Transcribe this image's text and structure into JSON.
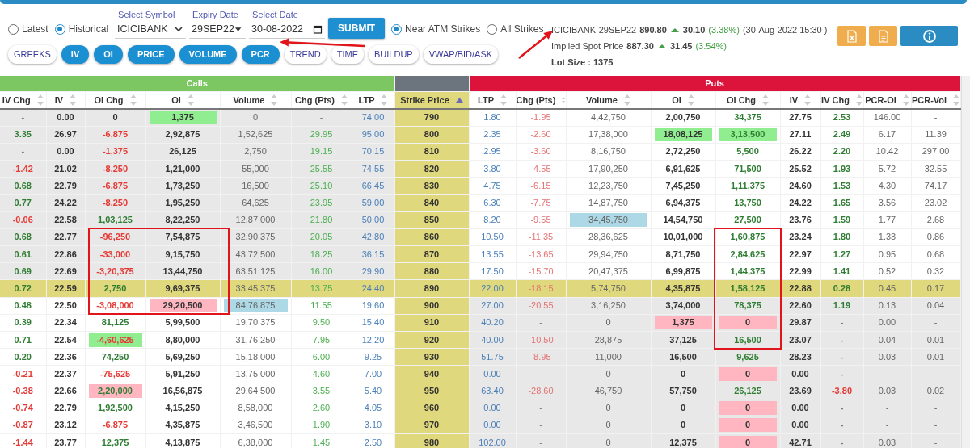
{
  "mode_options": [
    {
      "label": "Latest",
      "selected": false
    },
    {
      "label": "Historical",
      "selected": true
    }
  ],
  "symbol": {
    "label": "Select Symbol",
    "value": "ICICIBANK"
  },
  "expiry": {
    "label": "Expiry Date",
    "value": "29SEP22"
  },
  "date": {
    "label": "Select Date",
    "value": "30-08-2022"
  },
  "submit": "SUBMIT",
  "strike_options": [
    {
      "label": "Near ATM Strikes",
      "selected": true
    },
    {
      "label": "All Strikes",
      "selected": false
    }
  ],
  "view_tabs": [
    {
      "label": "GREEKS",
      "selected": false
    },
    {
      "label": "IV",
      "selected": true
    },
    {
      "label": "OI",
      "selected": true
    },
    {
      "label": "PRICE",
      "selected": true
    },
    {
      "label": "VOLUME",
      "selected": true
    },
    {
      "label": "PCR",
      "selected": true
    },
    {
      "label": "TREND",
      "selected": false
    },
    {
      "label": "TIME",
      "selected": false
    },
    {
      "label": "BUILDUP",
      "selected": false
    },
    {
      "label": "VWAP/BID/ASK",
      "selected": false
    }
  ],
  "quote": {
    "symbol": "ICICIBANK-29SEP22",
    "price": "890.80",
    "up": true,
    "change": "30.10",
    "percent": "(3.38%)",
    "time": "(30-Aug-2022 15:30 )"
  },
  "implied": {
    "label": "Implied Spot Price",
    "price": "887.30",
    "up": true,
    "change": "31.45",
    "percent": "(3.54%)"
  },
  "lot_size": "Lot Size : 1375",
  "toolbar": [
    {
      "kind": "excel"
    },
    {
      "kind": "document"
    },
    {
      "kind": "info"
    }
  ],
  "table": {
    "calls_title": "Calls",
    "puts_title": "Puts",
    "calls_columns": [
      {
        "label": "IV Chg",
        "kind": "change",
        "sorted": false
      },
      {
        "label": "IV",
        "kind": "iv",
        "sorted": false
      },
      {
        "label": "OI Chg",
        "kind": "oi_change",
        "sorted": false
      },
      {
        "label": "OI",
        "kind": "oi",
        "sorted": false
      },
      {
        "label": "Volume",
        "kind": "volume",
        "sorted": false
      },
      {
        "label": "Chg (Pts)",
        "kind": "points",
        "sorted": false
      },
      {
        "label": "LTP",
        "kind": "ltp",
        "sorted": false
      }
    ],
    "strike_column": {
      "label": "Strike Price",
      "sorted": true
    },
    "puts_columns": [
      {
        "label": "LTP",
        "kind": "ltp",
        "sorted": false
      },
      {
        "label": "Chg (Pts)",
        "kind": "points",
        "sorted": false
      },
      {
        "label": "Volume",
        "kind": "volume",
        "sorted": false
      },
      {
        "label": "OI",
        "kind": "oi",
        "sorted": false
      },
      {
        "label": "OI Chg",
        "kind": "oi_change",
        "sorted": false
      },
      {
        "label": "IV",
        "kind": "iv",
        "sorted": false
      },
      {
        "label": "IV Chg",
        "kind": "change",
        "sorted": false
      },
      {
        "label": "PCR-OI",
        "kind": "ratio",
        "sorted": false
      },
      {
        "label": "PCR-Vol",
        "kind": "ratio",
        "sorted": false
      }
    ],
    "rows": [
      {
        "strike": "790",
        "atm": false,
        "itm_calls": true,
        "itm_puts": false,
        "boxed_calls": false,
        "boxed_puts": false,
        "calls": [
          {
            "text": "-",
            "kind": "nil"
          },
          "0.00",
          {
            "text": "0",
            "kind": "nil"
          },
          {
            "text": "1,375",
            "color": "#90ee90"
          },
          "0",
          {
            "text": "-",
            "kind": "nil"
          },
          "74.00"
        ],
        "puts": [
          "1.80",
          {
            "text": "-1.95",
            "kind": "fall"
          },
          "4,42,750",
          "2,00,750",
          {
            "text": "34,375",
            "kind": "rise"
          },
          "27.75",
          {
            "text": "2.53",
            "kind": "rise"
          },
          "146.00",
          "-"
        ]
      },
      {
        "strike": "800",
        "atm": false,
        "itm_calls": true,
        "itm_puts": false,
        "boxed_calls": false,
        "boxed_puts": false,
        "calls": [
          {
            "text": "3.35",
            "kind": "rise"
          },
          "26.97",
          {
            "text": "-6,875",
            "kind": "fall"
          },
          "2,92,875",
          "1,52,625",
          {
            "text": "29.95",
            "kind": "rise"
          },
          "95.00"
        ],
        "puts": [
          "2.35",
          {
            "text": "-2.60",
            "kind": "fall"
          },
          "17,38,000",
          {
            "text": "18,08,125",
            "color": "#90ee90"
          },
          {
            "text": "3,13,500",
            "kind": "rise",
            "color": "#90ee90"
          },
          "27.11",
          {
            "text": "2.49",
            "kind": "rise"
          },
          "6.17",
          "11.39"
        ]
      },
      {
        "strike": "810",
        "atm": false,
        "itm_calls": true,
        "itm_puts": false,
        "boxed_calls": false,
        "boxed_puts": false,
        "calls": [
          {
            "text": "-",
            "kind": "nil"
          },
          "0.00",
          {
            "text": "-1,375",
            "kind": "fall"
          },
          "26,125",
          "2,750",
          {
            "text": "19.15",
            "kind": "rise"
          },
          "70.15"
        ],
        "puts": [
          "2.95",
          {
            "text": "-3.60",
            "kind": "fall"
          },
          "8,16,750",
          "2,72,250",
          {
            "text": "5,500",
            "kind": "rise"
          },
          "26.22",
          {
            "text": "2.20",
            "kind": "rise"
          },
          "10.42",
          "297.00"
        ]
      },
      {
        "strike": "820",
        "atm": false,
        "itm_calls": true,
        "itm_puts": false,
        "boxed_calls": false,
        "boxed_puts": false,
        "calls": [
          {
            "text": "-1.42",
            "kind": "fall"
          },
          "21.02",
          {
            "text": "-8,250",
            "kind": "fall"
          },
          "1,21,000",
          "55,000",
          {
            "text": "25.55",
            "kind": "rise"
          },
          "74.55"
        ],
        "puts": [
          "3.80",
          {
            "text": "-4.55",
            "kind": "fall"
          },
          "17,90,250",
          "6,91,625",
          {
            "text": "71,500",
            "kind": "rise"
          },
          "25.52",
          {
            "text": "1.93",
            "kind": "rise"
          },
          "5.72",
          "32.55"
        ]
      },
      {
        "strike": "830",
        "atm": false,
        "itm_calls": true,
        "itm_puts": false,
        "boxed_calls": false,
        "boxed_puts": false,
        "calls": [
          {
            "text": "0.68",
            "kind": "rise"
          },
          "22.79",
          {
            "text": "-6,875",
            "kind": "fall"
          },
          "1,73,250",
          "16,500",
          {
            "text": "25.10",
            "kind": "rise"
          },
          "66.45"
        ],
        "puts": [
          "4.75",
          {
            "text": "-6.15",
            "kind": "fall"
          },
          "12,23,750",
          "7,45,250",
          {
            "text": "1,11,375",
            "kind": "rise"
          },
          "24.60",
          {
            "text": "1.53",
            "kind": "rise"
          },
          "4.30",
          "74.17"
        ]
      },
      {
        "strike": "840",
        "atm": false,
        "itm_calls": true,
        "itm_puts": false,
        "boxed_calls": false,
        "boxed_puts": false,
        "calls": [
          {
            "text": "0.77",
            "kind": "rise"
          },
          "24.22",
          {
            "text": "-8,250",
            "kind": "fall"
          },
          "1,95,250",
          "64,625",
          {
            "text": "23.95",
            "kind": "rise"
          },
          "59.00"
        ],
        "puts": [
          "6.30",
          {
            "text": "-7.75",
            "kind": "fall"
          },
          "14,87,750",
          "6,94,375",
          {
            "text": "13,750",
            "kind": "rise"
          },
          "24.22",
          {
            "text": "1.65",
            "kind": "rise"
          },
          "3.56",
          "23.02"
        ]
      },
      {
        "strike": "850",
        "atm": false,
        "itm_calls": true,
        "itm_puts": false,
        "boxed_calls": false,
        "boxed_puts": false,
        "calls": [
          {
            "text": "-0.06",
            "kind": "fall"
          },
          "22.58",
          {
            "text": "1,03,125",
            "kind": "rise"
          },
          "8,22,250",
          "12,87,000",
          {
            "text": "21.80",
            "kind": "rise"
          },
          "50.00"
        ],
        "puts": [
          "8.20",
          {
            "text": "-9.55",
            "kind": "fall"
          },
          {
            "text": "34,45,750",
            "color": "#add8e6"
          },
          "14,54,750",
          {
            "text": "27,500",
            "kind": "rise"
          },
          "23.76",
          {
            "text": "1.59",
            "kind": "rise"
          },
          "1.77",
          "2.68"
        ]
      },
      {
        "strike": "860",
        "atm": false,
        "itm_calls": true,
        "itm_puts": false,
        "boxed_calls": true,
        "boxed_puts": true,
        "calls": [
          {
            "text": "0.68",
            "kind": "rise"
          },
          "22.77",
          {
            "text": "-96,250",
            "kind": "fall"
          },
          "7,54,875",
          "32,90,375",
          {
            "text": "20.05",
            "kind": "rise"
          },
          "42.80"
        ],
        "puts": [
          "10.50",
          {
            "text": "-11.35",
            "kind": "fall"
          },
          "28,36,625",
          "10,01,000",
          {
            "text": "1,60,875",
            "kind": "rise"
          },
          "23.24",
          {
            "text": "1.80",
            "kind": "rise"
          },
          "1.33",
          "0.86"
        ]
      },
      {
        "strike": "870",
        "atm": false,
        "itm_calls": true,
        "itm_puts": false,
        "boxed_calls": true,
        "boxed_puts": true,
        "calls": [
          {
            "text": "0.61",
            "kind": "rise"
          },
          "22.86",
          {
            "text": "-33,000",
            "kind": "fall"
          },
          "9,15,750",
          "43,72,500",
          {
            "text": "18.25",
            "kind": "rise"
          },
          "36.15"
        ],
        "puts": [
          "13.55",
          {
            "text": "-13.65",
            "kind": "fall"
          },
          "29,94,750",
          "8,71,750",
          {
            "text": "2,84,625",
            "kind": "rise"
          },
          "22.97",
          {
            "text": "1.27",
            "kind": "rise"
          },
          "0.95",
          "0.68"
        ]
      },
      {
        "strike": "880",
        "atm": false,
        "itm_calls": true,
        "itm_puts": false,
        "boxed_calls": true,
        "boxed_puts": true,
        "calls": [
          {
            "text": "0.69",
            "kind": "rise"
          },
          "22.69",
          {
            "text": "-3,20,375",
            "kind": "fall"
          },
          "13,44,750",
          "63,51,125",
          {
            "text": "16.00",
            "kind": "rise"
          },
          "29.90"
        ],
        "puts": [
          "17.50",
          {
            "text": "-15.70",
            "kind": "fall"
          },
          "20,47,375",
          "6,99,875",
          {
            "text": "1,44,375",
            "kind": "rise"
          },
          "22.99",
          {
            "text": "1.41",
            "kind": "rise"
          },
          "0.52",
          "0.32"
        ]
      },
      {
        "strike": "890",
        "atm": true,
        "itm_calls": false,
        "itm_puts": false,
        "boxed_calls": true,
        "boxed_puts": true,
        "calls": [
          {
            "text": "0.72",
            "kind": "rise"
          },
          "22.59",
          {
            "text": "2,750",
            "kind": "rise"
          },
          "9,69,375",
          "33,45,375",
          {
            "text": "13.75",
            "kind": "rise"
          },
          "24.40"
        ],
        "puts": [
          "22.00",
          {
            "text": "-18.15",
            "kind": "fall"
          },
          "5,74,750",
          "4,35,875",
          {
            "text": "1,58,125",
            "kind": "rise"
          },
          "22.88",
          {
            "text": "0.28",
            "kind": "rise"
          },
          "0.45",
          "0.17"
        ]
      },
      {
        "strike": "900",
        "atm": false,
        "itm_calls": false,
        "itm_puts": true,
        "boxed_calls": true,
        "boxed_puts": true,
        "calls": [
          {
            "text": "0.48",
            "kind": "rise"
          },
          "22.50",
          {
            "text": "-3,08,000",
            "kind": "fall"
          },
          {
            "text": "29,20,500",
            "color": "#ffb6c1"
          },
          {
            "text": "84,76,875",
            "color": "#add8e6"
          },
          {
            "text": "11.55",
            "kind": "rise"
          },
          "19.60"
        ],
        "puts": [
          "27.00",
          {
            "text": "-20.55",
            "kind": "fall"
          },
          "3,16,250",
          "3,74,000",
          {
            "text": "78,375",
            "kind": "rise"
          },
          "22.60",
          {
            "text": "1.19",
            "kind": "rise"
          },
          "0.13",
          "0.04"
        ]
      },
      {
        "strike": "910",
        "atm": false,
        "itm_calls": false,
        "itm_puts": true,
        "boxed_calls": false,
        "boxed_puts": true,
        "calls": [
          {
            "text": "0.39",
            "kind": "rise"
          },
          "22.34",
          {
            "text": "81,125",
            "kind": "rise"
          },
          "5,99,500",
          "19,70,375",
          {
            "text": "9.50",
            "kind": "rise"
          },
          "15.40"
        ],
        "puts": [
          "40.20",
          {
            "text": "-",
            "kind": "nil"
          },
          "0",
          {
            "text": "1,375",
            "color": "#ffb6c1"
          },
          {
            "text": "0",
            "kind": "nil",
            "color": "#ffb6c1"
          },
          "29.87",
          {
            "text": "-",
            "kind": "nil"
          },
          "0.00",
          "-"
        ]
      },
      {
        "strike": "920",
        "atm": false,
        "itm_calls": false,
        "itm_puts": true,
        "boxed_calls": false,
        "boxed_puts": true,
        "calls": [
          {
            "text": "0.71",
            "kind": "rise"
          },
          "22.54",
          {
            "text": "-4,60,625",
            "kind": "fall",
            "color": "#90ee90"
          },
          "8,80,000",
          "31,76,250",
          {
            "text": "7.95",
            "kind": "rise"
          },
          "12.20"
        ],
        "puts": [
          "40.00",
          {
            "text": "-10.50",
            "kind": "fall"
          },
          "28,875",
          "37,125",
          {
            "text": "16,500",
            "kind": "rise"
          },
          "23.07",
          {
            "text": "-",
            "kind": "nil"
          },
          "0.04",
          "0.01"
        ]
      },
      {
        "strike": "930",
        "atm": false,
        "itm_calls": false,
        "itm_puts": true,
        "boxed_calls": false,
        "boxed_puts": false,
        "calls": [
          {
            "text": "0.20",
            "kind": "rise"
          },
          "22.36",
          {
            "text": "74,250",
            "kind": "rise"
          },
          "5,69,250",
          "15,18,000",
          {
            "text": "6.00",
            "kind": "rise"
          },
          "9.25"
        ],
        "puts": [
          "51.75",
          {
            "text": "-8.95",
            "kind": "fall"
          },
          "11,000",
          "16,500",
          {
            "text": "9,625",
            "kind": "rise"
          },
          "28.23",
          {
            "text": "-",
            "kind": "nil"
          },
          "0.03",
          "0.01"
        ]
      },
      {
        "strike": "940",
        "atm": false,
        "itm_calls": false,
        "itm_puts": true,
        "boxed_calls": false,
        "boxed_puts": false,
        "calls": [
          {
            "text": "-0.21",
            "kind": "fall"
          },
          "22.37",
          {
            "text": "-75,625",
            "kind": "fall"
          },
          "5,91,250",
          "13,75,000",
          {
            "text": "4.60",
            "kind": "rise"
          },
          "7.00"
        ],
        "puts": [
          "0.00",
          {
            "text": "-",
            "kind": "nil"
          },
          "0",
          "0",
          {
            "text": "0",
            "kind": "nil",
            "color": "#ffb6c1"
          },
          "0.00",
          {
            "text": "-",
            "kind": "nil"
          },
          "-",
          "-"
        ]
      },
      {
        "strike": "950",
        "atm": false,
        "itm_calls": false,
        "itm_puts": true,
        "boxed_calls": false,
        "boxed_puts": false,
        "calls": [
          {
            "text": "-0.38",
            "kind": "fall"
          },
          "22.66",
          {
            "text": "2,20,000",
            "kind": "rise",
            "color": "#ffb6c1"
          },
          "16,56,875",
          "29,64,500",
          {
            "text": "3.55",
            "kind": "rise"
          },
          "5.40"
        ],
        "puts": [
          "63.40",
          {
            "text": "-28.60",
            "kind": "fall"
          },
          "46,750",
          "57,750",
          {
            "text": "26,125",
            "kind": "rise"
          },
          "23.69",
          {
            "text": "-3.80",
            "kind": "fall"
          },
          "0.03",
          "0.02"
        ]
      },
      {
        "strike": "960",
        "atm": false,
        "itm_calls": false,
        "itm_puts": true,
        "boxed_calls": false,
        "boxed_puts": false,
        "calls": [
          {
            "text": "-0.74",
            "kind": "fall"
          },
          "22.79",
          {
            "text": "1,92,500",
            "kind": "rise"
          },
          "4,15,250",
          "8,58,000",
          {
            "text": "2.60",
            "kind": "rise"
          },
          "4.05"
        ],
        "puts": [
          "0.00",
          {
            "text": "-",
            "kind": "nil"
          },
          "0",
          "0",
          {
            "text": "0",
            "kind": "nil",
            "color": "#ffb6c1"
          },
          "0.00",
          {
            "text": "-",
            "kind": "nil"
          },
          "-",
          "-"
        ]
      },
      {
        "strike": "970",
        "atm": false,
        "itm_calls": false,
        "itm_puts": true,
        "boxed_calls": false,
        "boxed_puts": false,
        "calls": [
          {
            "text": "-0.87",
            "kind": "fall"
          },
          "23.12",
          {
            "text": "-6,875",
            "kind": "fall"
          },
          "4,35,875",
          "3,46,500",
          {
            "text": "1.90",
            "kind": "rise"
          },
          "3.10"
        ],
        "puts": [
          "0.00",
          {
            "text": "-",
            "kind": "nil"
          },
          "0",
          "0",
          {
            "text": "0",
            "kind": "nil",
            "color": "#ffb6c1"
          },
          "0.00",
          {
            "text": "-",
            "kind": "nil"
          },
          "-",
          "-"
        ]
      },
      {
        "strike": "980",
        "atm": false,
        "itm_calls": false,
        "itm_puts": true,
        "boxed_calls": false,
        "boxed_puts": false,
        "calls": [
          {
            "text": "-1.44",
            "kind": "fall"
          },
          "23.77",
          {
            "text": "12,375",
            "kind": "rise"
          },
          "4,13,875",
          "6,38,000",
          {
            "text": "1.45",
            "kind": "rise"
          },
          "2.50"
        ],
        "puts": [
          "102.00",
          {
            "text": "-",
            "kind": "nil"
          },
          "0",
          "12,375",
          {
            "text": "0",
            "kind": "nil",
            "color": "#ffb6c1"
          },
          "42.71",
          {
            "text": "-",
            "kind": "nil"
          },
          "0.03",
          "-"
        ]
      }
    ]
  },
  "annotations": [
    {
      "kind": "date_arrow"
    },
    {
      "kind": "quote_arrow"
    },
    {
      "kind": "calls_box"
    },
    {
      "kind": "puts_box"
    }
  ]
}
